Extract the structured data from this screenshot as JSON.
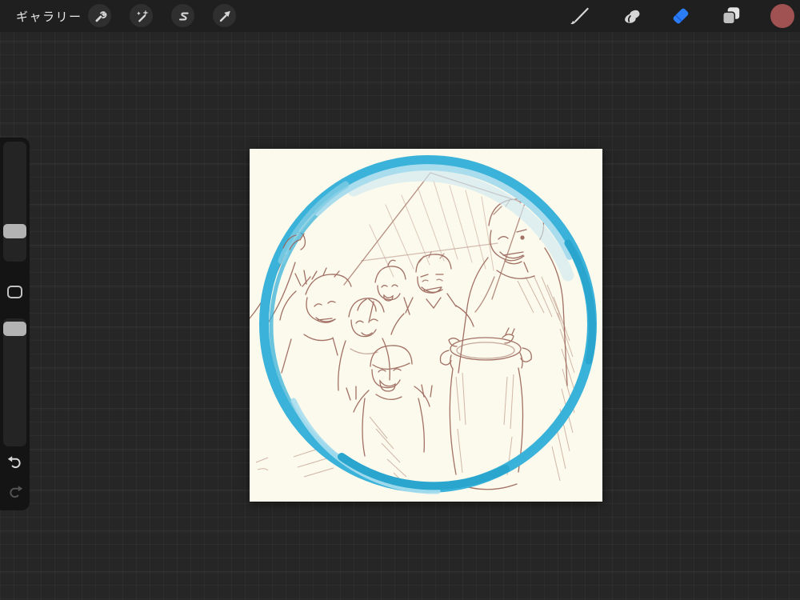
{
  "topbar": {
    "gallery_label": "ギャラリー",
    "left_tools": [
      {
        "id": "actions",
        "icon": "wrench-icon"
      },
      {
        "id": "adjustments",
        "icon": "magic-wand-icon"
      },
      {
        "id": "selection",
        "icon": "selection-s-icon"
      },
      {
        "id": "transform",
        "icon": "transform-arrow-icon"
      }
    ],
    "right_tools": [
      {
        "id": "paint",
        "icon": "brush-icon",
        "active": false
      },
      {
        "id": "smudge",
        "icon": "smudge-icon",
        "active": false
      },
      {
        "id": "erase",
        "icon": "eraser-icon",
        "active": true
      },
      {
        "id": "layers",
        "icon": "layers-icon",
        "active": false
      },
      {
        "id": "color",
        "icon": "color-swatch-dot",
        "active": false
      }
    ],
    "active_tool_color": "#2b7cf7",
    "inactive_tool_color": "#d6d6d6",
    "color_swatch_hex": "#a05151",
    "color_swatch_style": "background:#a05151"
  },
  "sidebar": {
    "sliders": [
      {
        "name": "brush-size",
        "handle_style": "top:108px"
      },
      {
        "name": "opacity",
        "handle_style": "top:230px"
      }
    ],
    "size_handle_style": "top:108px",
    "opacity_handle_style": "top:230px",
    "buttons": [
      "modify",
      "undo",
      "redo"
    ],
    "redo_disabled": true
  },
  "canvas": {
    "style": "background:#fbfaec",
    "background_hex": "#fbfaec",
    "artwork": {
      "description": "sepia pencil sketch of six smiling friends posing for a group selfie around a large metal milk can, framed by a hand-painted blue circle; a hand at top-left grips the ring",
      "sketch_color": "#9b655a",
      "ring_color": "#3ab2d9",
      "ring_highlight": "#a9ddee"
    }
  },
  "workspace": {
    "background_hex": "#262626",
    "grid_visible": true,
    "topbar_background_hex": "#1f1f1f"
  }
}
